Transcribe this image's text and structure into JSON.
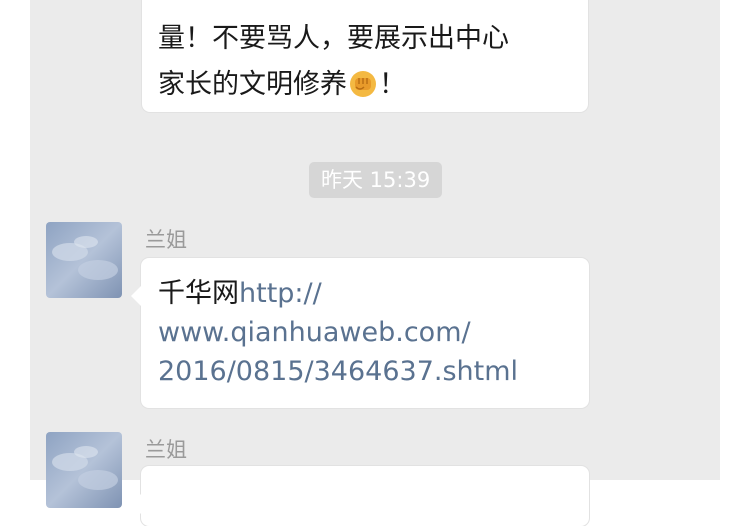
{
  "top_message": {
    "line1": "",
    "line2": "量！不要骂人，要展示出中心",
    "line3_text": "家长的文明修养",
    "line3_end": "！",
    "emoji": "fist-emoji"
  },
  "timestamp": "昨天 15:39",
  "messages": [
    {
      "sender": "兰姐",
      "title": "千华网",
      "url_part1": "http://",
      "url_part2": "www.qianhuaweb.com/",
      "url_part3": "2016/0815/3464637.shtml"
    },
    {
      "sender": "兰姐"
    }
  ],
  "colors": {
    "chat_background": "#ebebeb",
    "link": "#5a7290",
    "timestamp_badge": "#d6d6d6",
    "sender_name": "#9a9a9a"
  }
}
